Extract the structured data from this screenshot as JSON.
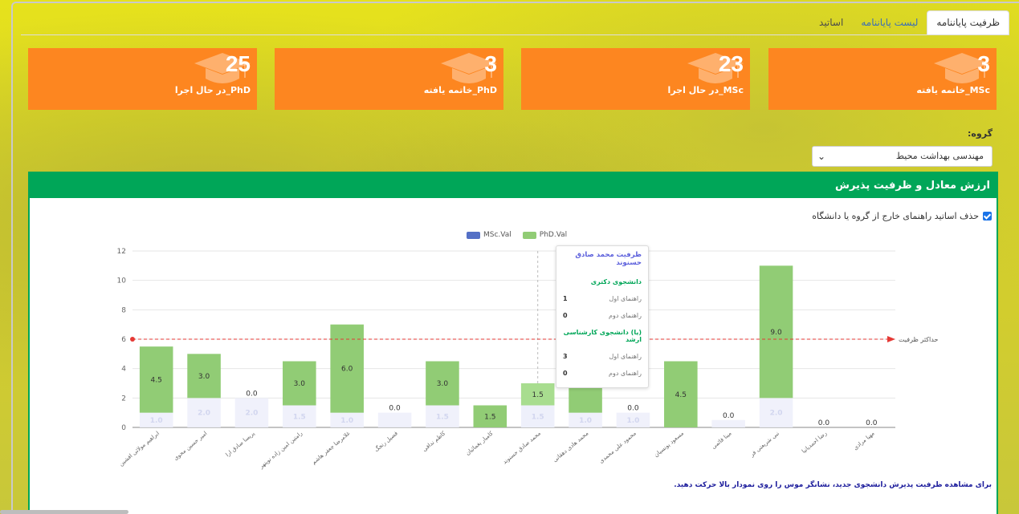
{
  "tabs": [
    {
      "label": "ظرفیت پایاننامه",
      "active": true
    },
    {
      "label": "لیست پایاننامه",
      "active": false
    },
    {
      "label": "اساتید",
      "active": false
    }
  ],
  "stats": [
    {
      "value": "3",
      "label": "MSc_خاتمه یافته"
    },
    {
      "value": "23",
      "label": "MSc_در حال اجرا"
    },
    {
      "value": "3",
      "label": "PhD_خاتمه یافته"
    },
    {
      "value": "25",
      "label": "PhD_در حال اجرا"
    }
  ],
  "group": {
    "label": "گروه:",
    "selected": "مهندسی بهداشت محیط"
  },
  "panel": {
    "title": "ارزش معادل و ظرفیت پذیرش",
    "checkbox_label": "حذف اساتید راهنمای خارج از گروه یا دانشگاه",
    "footnote": "برای مشاهده ظرفیت پذیرش دانشجوی جدید، نشانگر موس را روی نمودار بالا حرکت دهید."
  },
  "chart_data": {
    "type": "bar",
    "stacked": true,
    "ylim": [
      0,
      12
    ],
    "yticks": [
      0,
      2,
      4,
      6,
      8,
      10,
      12
    ],
    "grid": true,
    "legend_position": "top",
    "capacity_line": {
      "value": 6,
      "label": "حداکثر ظرفیت",
      "color": "#e53935"
    },
    "categories": [
      "ابراهیم مولائی افشین",
      "امیر حسین محوی",
      "پریسا صادق ارا",
      "رامتین امین زاده نوینهر",
      "غلامرضا جعفر هاشم",
      "فصیل رنجگ",
      "کاظم ندافی",
      "کامیار یغمائیان",
      "محمد صادق حسنوند",
      "محمد هادی دهقانی",
      "محمود علی محمدی",
      "مسعود یونسیان",
      "مینا قائمی",
      "نبی شریعتی فر",
      "رضا احمدیانیا",
      "مهیا مرادی"
    ],
    "series": [
      {
        "name": "MSc.Val",
        "color": "#5470c6",
        "values": [
          1.0,
          2.0,
          2.0,
          1.5,
          1.0,
          1.0,
          1.5,
          0,
          1.5,
          1.0,
          1.0,
          0,
          0.5,
          2.0,
          0,
          0
        ]
      },
      {
        "name": "PhD.Val",
        "color": "#91cc75",
        "values": [
          4.5,
          3.0,
          0.0,
          3.0,
          6.0,
          0.0,
          3.0,
          1.5,
          1.5,
          4.0,
          0.0,
          4.5,
          0.0,
          9.0,
          0.0,
          0.0
        ]
      }
    ],
    "bar_labels": [
      "4.5",
      "3.0",
      "0.0",
      "3.0",
      "6.0",
      "0.0",
      "3.0",
      "1.5",
      "1.5",
      "",
      "0.0",
      "4.5",
      "0.0",
      "9.0",
      "0.0",
      "0.0"
    ],
    "msc_labels": [
      "1.0",
      "2.0",
      "2.0",
      "1.5",
      "1.0",
      "",
      "1.5",
      "",
      "1.5",
      "1.0",
      "1.0",
      "",
      "",
      "2.0",
      "",
      ""
    ],
    "highlighted_index": 8
  },
  "tooltip": {
    "title": "ظرفیت محمد صادق حسنوند",
    "sections": [
      {
        "title": "دانشجوی دکتری",
        "rows": [
          {
            "label": "راهنمای اول",
            "value": "1"
          },
          {
            "label": "راهنمای دوم",
            "value": "0"
          }
        ]
      },
      {
        "title": "(یا) دانشجوی کارشناسی ارشد",
        "rows": [
          {
            "label": "راهنمای اول",
            "value": "3"
          },
          {
            "label": "راهنمای دوم",
            "value": "0"
          }
        ]
      }
    ]
  }
}
